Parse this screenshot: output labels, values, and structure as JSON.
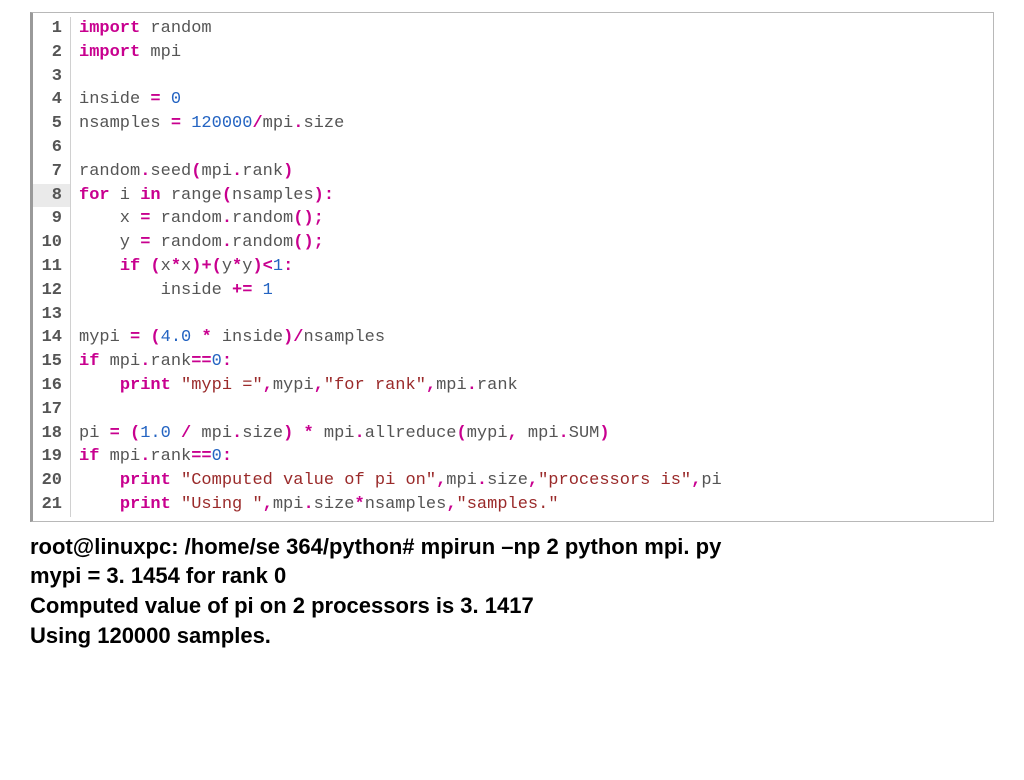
{
  "code": {
    "lines": [
      {
        "n": "1",
        "hl": false,
        "tokens": [
          [
            "kw",
            "import"
          ],
          [
            "ident",
            " random"
          ]
        ]
      },
      {
        "n": "2",
        "hl": false,
        "tokens": [
          [
            "kw",
            "import"
          ],
          [
            "ident",
            " mpi"
          ]
        ]
      },
      {
        "n": "3",
        "hl": false,
        "tokens": [
          [
            "ident",
            ""
          ]
        ]
      },
      {
        "n": "4",
        "hl": false,
        "tokens": [
          [
            "ident",
            "inside "
          ],
          [
            "punct",
            "="
          ],
          [
            "ident",
            " "
          ],
          [
            "num",
            "0"
          ]
        ]
      },
      {
        "n": "5",
        "hl": false,
        "tokens": [
          [
            "ident",
            "nsamples "
          ],
          [
            "punct",
            "="
          ],
          [
            "ident",
            " "
          ],
          [
            "num",
            "120000"
          ],
          [
            "punct",
            "/"
          ],
          [
            "ident",
            "mpi"
          ],
          [
            "punct",
            "."
          ],
          [
            "ident",
            "size"
          ]
        ]
      },
      {
        "n": "6",
        "hl": false,
        "tokens": [
          [
            "ident",
            ""
          ]
        ]
      },
      {
        "n": "7",
        "hl": false,
        "tokens": [
          [
            "ident",
            "random"
          ],
          [
            "punct",
            "."
          ],
          [
            "ident",
            "seed"
          ],
          [
            "punct",
            "("
          ],
          [
            "ident",
            "mpi"
          ],
          [
            "punct",
            "."
          ],
          [
            "ident",
            "rank"
          ],
          [
            "punct",
            ")"
          ]
        ]
      },
      {
        "n": "8",
        "hl": true,
        "tokens": [
          [
            "kw",
            "for"
          ],
          [
            "ident",
            " i "
          ],
          [
            "kw",
            "in"
          ],
          [
            "ident",
            " range"
          ],
          [
            "punct",
            "("
          ],
          [
            "ident",
            "nsamples"
          ],
          [
            "punct",
            ")"
          ],
          [
            "punct",
            ":"
          ]
        ]
      },
      {
        "n": "9",
        "hl": false,
        "tokens": [
          [
            "ident",
            "    x "
          ],
          [
            "punct",
            "="
          ],
          [
            "ident",
            " random"
          ],
          [
            "punct",
            "."
          ],
          [
            "ident",
            "random"
          ],
          [
            "punct",
            "("
          ],
          [
            "punct",
            ")"
          ],
          [
            "punct",
            ";"
          ]
        ]
      },
      {
        "n": "10",
        "hl": false,
        "tokens": [
          [
            "ident",
            "    y "
          ],
          [
            "punct",
            "="
          ],
          [
            "ident",
            " random"
          ],
          [
            "punct",
            "."
          ],
          [
            "ident",
            "random"
          ],
          [
            "punct",
            "("
          ],
          [
            "punct",
            ")"
          ],
          [
            "punct",
            ";"
          ]
        ]
      },
      {
        "n": "11",
        "hl": false,
        "tokens": [
          [
            "ident",
            "    "
          ],
          [
            "kw",
            "if"
          ],
          [
            "ident",
            " "
          ],
          [
            "punct",
            "("
          ],
          [
            "ident",
            "x"
          ],
          [
            "punct",
            "*"
          ],
          [
            "ident",
            "x"
          ],
          [
            "punct",
            ")"
          ],
          [
            "punct",
            "+"
          ],
          [
            "punct",
            "("
          ],
          [
            "ident",
            "y"
          ],
          [
            "punct",
            "*"
          ],
          [
            "ident",
            "y"
          ],
          [
            "punct",
            ")"
          ],
          [
            "punct",
            "<"
          ],
          [
            "num",
            "1"
          ],
          [
            "punct",
            ":"
          ]
        ]
      },
      {
        "n": "12",
        "hl": false,
        "tokens": [
          [
            "ident",
            "        inside "
          ],
          [
            "punct",
            "+="
          ],
          [
            "ident",
            " "
          ],
          [
            "num",
            "1"
          ]
        ]
      },
      {
        "n": "13",
        "hl": false,
        "tokens": [
          [
            "ident",
            ""
          ]
        ]
      },
      {
        "n": "14",
        "hl": false,
        "tokens": [
          [
            "ident",
            "mypi "
          ],
          [
            "punct",
            "="
          ],
          [
            "ident",
            " "
          ],
          [
            "punct",
            "("
          ],
          [
            "num",
            "4.0"
          ],
          [
            "ident",
            " "
          ],
          [
            "punct",
            "*"
          ],
          [
            "ident",
            " inside"
          ],
          [
            "punct",
            ")"
          ],
          [
            "punct",
            "/"
          ],
          [
            "ident",
            "nsamples"
          ]
        ]
      },
      {
        "n": "15",
        "hl": false,
        "tokens": [
          [
            "kw",
            "if"
          ],
          [
            "ident",
            " mpi"
          ],
          [
            "punct",
            "."
          ],
          [
            "ident",
            "rank"
          ],
          [
            "punct",
            "=="
          ],
          [
            "num",
            "0"
          ],
          [
            "punct",
            ":"
          ]
        ]
      },
      {
        "n": "16",
        "hl": false,
        "tokens": [
          [
            "ident",
            "    "
          ],
          [
            "kw",
            "print"
          ],
          [
            "ident",
            " "
          ],
          [
            "str",
            "\"mypi =\""
          ],
          [
            "punct",
            ","
          ],
          [
            "ident",
            "mypi"
          ],
          [
            "punct",
            ","
          ],
          [
            "str",
            "\"for rank\""
          ],
          [
            "punct",
            ","
          ],
          [
            "ident",
            "mpi"
          ],
          [
            "punct",
            "."
          ],
          [
            "ident",
            "rank"
          ]
        ]
      },
      {
        "n": "17",
        "hl": false,
        "tokens": [
          [
            "ident",
            ""
          ]
        ]
      },
      {
        "n": "18",
        "hl": false,
        "tokens": [
          [
            "ident",
            "pi "
          ],
          [
            "punct",
            "="
          ],
          [
            "ident",
            " "
          ],
          [
            "punct",
            "("
          ],
          [
            "num",
            "1.0"
          ],
          [
            "ident",
            " "
          ],
          [
            "punct",
            "/"
          ],
          [
            "ident",
            " mpi"
          ],
          [
            "punct",
            "."
          ],
          [
            "ident",
            "size"
          ],
          [
            "punct",
            ")"
          ],
          [
            "ident",
            " "
          ],
          [
            "punct",
            "*"
          ],
          [
            "ident",
            " mpi"
          ],
          [
            "punct",
            "."
          ],
          [
            "ident",
            "allreduce"
          ],
          [
            "punct",
            "("
          ],
          [
            "ident",
            "mypi"
          ],
          [
            "punct",
            ","
          ],
          [
            "ident",
            " mpi"
          ],
          [
            "punct",
            "."
          ],
          [
            "ident",
            "SUM"
          ],
          [
            "punct",
            ")"
          ]
        ]
      },
      {
        "n": "19",
        "hl": false,
        "tokens": [
          [
            "kw",
            "if"
          ],
          [
            "ident",
            " mpi"
          ],
          [
            "punct",
            "."
          ],
          [
            "ident",
            "rank"
          ],
          [
            "punct",
            "=="
          ],
          [
            "num",
            "0"
          ],
          [
            "punct",
            ":"
          ]
        ]
      },
      {
        "n": "20",
        "hl": false,
        "tokens": [
          [
            "ident",
            "    "
          ],
          [
            "kw",
            "print"
          ],
          [
            "ident",
            " "
          ],
          [
            "str",
            "\"Computed value of pi on\""
          ],
          [
            "punct",
            ","
          ],
          [
            "ident",
            "mpi"
          ],
          [
            "punct",
            "."
          ],
          [
            "ident",
            "size"
          ],
          [
            "punct",
            ","
          ],
          [
            "str",
            "\"processors is\""
          ],
          [
            "punct",
            ","
          ],
          [
            "ident",
            "pi"
          ]
        ]
      },
      {
        "n": "21",
        "hl": false,
        "tokens": [
          [
            "ident",
            "    "
          ],
          [
            "kw",
            "print"
          ],
          [
            "ident",
            " "
          ],
          [
            "str",
            "\"Using \""
          ],
          [
            "punct",
            ","
          ],
          [
            "ident",
            "mpi"
          ],
          [
            "punct",
            "."
          ],
          [
            "ident",
            "size"
          ],
          [
            "punct",
            "*"
          ],
          [
            "ident",
            "nsamples"
          ],
          [
            "punct",
            ","
          ],
          [
            "str",
            "\"samples.\""
          ]
        ]
      }
    ]
  },
  "terminal": {
    "lines": [
      "root@linuxpc: /home/se 364/python# mpirun –np 2 python mpi. py",
      "mypi = 3. 1454 for rank 0",
      "Computed value of pi on 2 processors is 3. 1417",
      "Using  120000 samples."
    ]
  }
}
